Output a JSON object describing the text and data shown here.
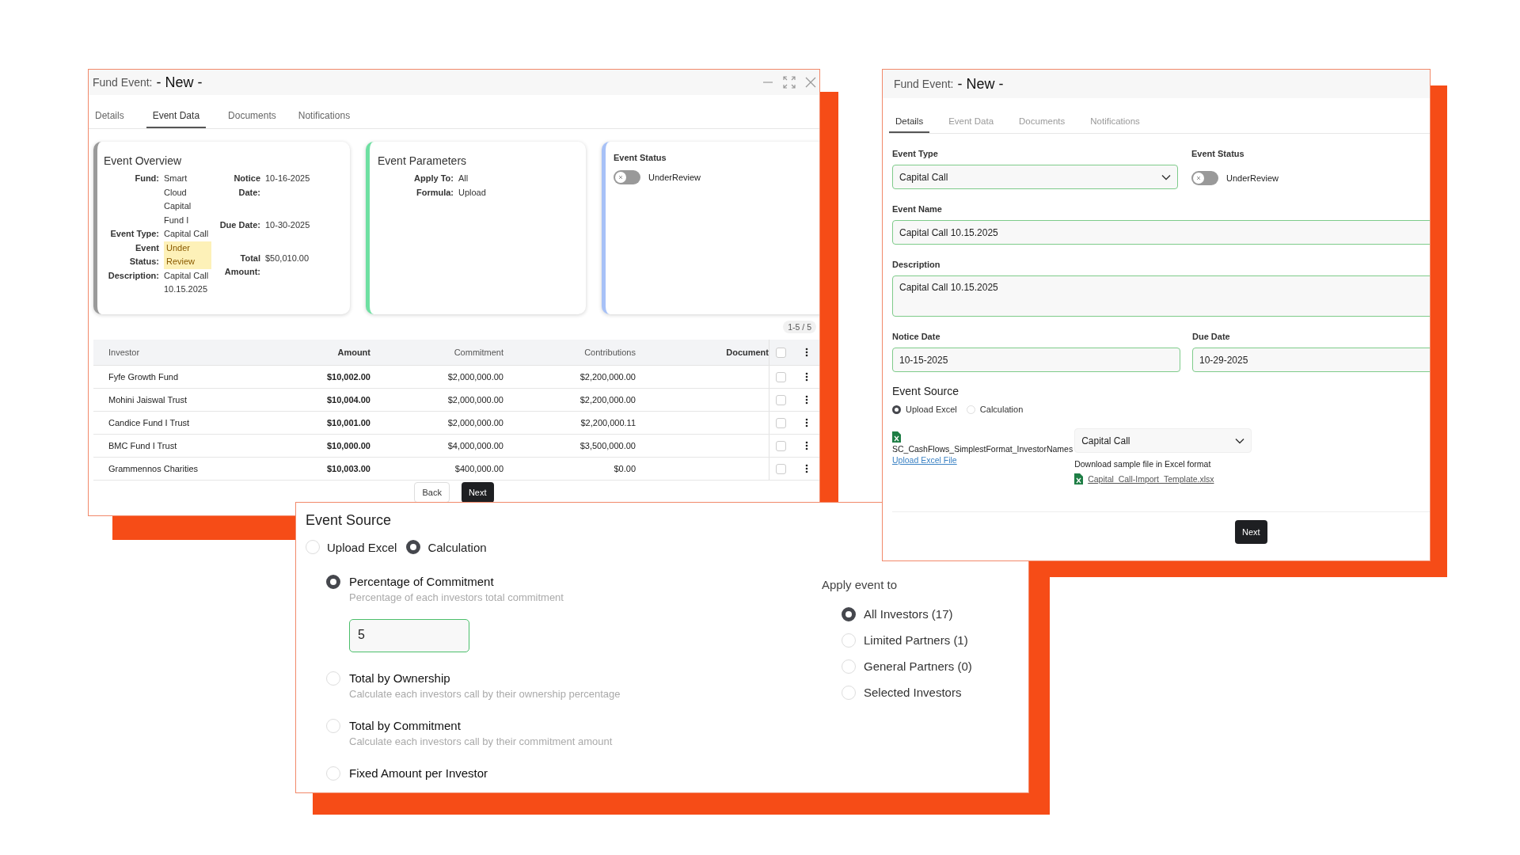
{
  "event_data_window": {
    "title_prefix": "Fund Event:",
    "title": "- New -",
    "tabs": [
      {
        "label": "Details",
        "selected": false
      },
      {
        "label": "Event Data",
        "selected": true
      },
      {
        "label": "Documents",
        "selected": false
      },
      {
        "label": "Notifications",
        "selected": false
      }
    ],
    "overview": {
      "title": "Event Overview",
      "left_fields": [
        {
          "label": "Fund:",
          "value": "Smart Cloud Capital Fund I",
          "highlighted": false
        },
        {
          "label": "Event Type:",
          "value": "Capital Call",
          "highlighted": false
        },
        {
          "label": "Event Status:",
          "value": "Under Review",
          "highlighted": true
        },
        {
          "label": "Description:",
          "value": "Capital Call 10.15.2025",
          "highlighted": false
        }
      ],
      "right_fields": [
        {
          "label": "Notice Date:",
          "value": "10-16-2025"
        },
        {
          "label": "Due Date:",
          "value": "10-30-2025"
        },
        {
          "label": "Total Amount:",
          "value": "$50,010.00"
        }
      ]
    },
    "parameters": {
      "title": "Event Parameters",
      "fields": [
        {
          "label": "Apply To:",
          "value": "All"
        },
        {
          "label": "Formula:",
          "value": "Upload"
        }
      ]
    },
    "status": {
      "title": "Event Status",
      "on": false,
      "label": "UnderReview"
    },
    "pagination": "1-5 / 5",
    "table": {
      "columns": [
        "Investor",
        "Amount",
        "Commitment",
        "Contributions",
        "Document"
      ],
      "all_checked": false,
      "rows": [
        {
          "investor": "Fyfe Growth Fund",
          "amount": "$10,002.00",
          "commitment": "$2,000,000.00",
          "contributions": "$2,200,000.00",
          "checked": false
        },
        {
          "investor": "Mohini Jaiswal Trust",
          "amount": "$10,004.00",
          "commitment": "$2,000,000.00",
          "contributions": "$2,200,000.00",
          "checked": false
        },
        {
          "investor": "Candice Fund I Trust",
          "amount": "$10,001.00",
          "commitment": "$2,000,000.00",
          "contributions": "$2,200,000.11",
          "checked": false
        },
        {
          "investor": "BMC Fund I Trust",
          "amount": "$10,000.00",
          "commitment": "$4,000,000.00",
          "contributions": "$3,500,000.00",
          "checked": false
        },
        {
          "investor": "Grammennos Charities",
          "amount": "$10,003.00",
          "commitment": "$400,000.00",
          "contributions": "$0.00",
          "checked": false
        }
      ]
    },
    "buttons": [
      "Back",
      "Next"
    ]
  },
  "details_window": {
    "title_prefix": "Fund Event:",
    "title": "- New -",
    "tabs": [
      {
        "label": "Details",
        "selected": true
      },
      {
        "label": "Event Data",
        "selected": false
      },
      {
        "label": "Documents",
        "selected": false
      },
      {
        "label": "Notifications",
        "selected": false
      }
    ],
    "event_type": {
      "label": "Event Type",
      "value": "Capital Call"
    },
    "event_status": {
      "label": "Event Status",
      "on": false,
      "text": "UnderReview"
    },
    "event_name": {
      "label": "Event Name",
      "value": "Capital Call 10.15.2025"
    },
    "description": {
      "label": "Description",
      "value": "Capital Call 10.15.2025"
    },
    "notice_date": {
      "label": "Notice Date",
      "value": "10-15-2025"
    },
    "due_date": {
      "label": "Due Date",
      "value": "10-29-2025"
    },
    "event_source": {
      "title": "Event Source",
      "options": [
        {
          "label": "Upload Excel",
          "selected": true
        },
        {
          "label": "Calculation",
          "selected": false
        }
      ]
    },
    "file_name": "SC_CashFlows_SimplestFormat_InvestorNames",
    "upload_link": "Upload Excel File",
    "template_select": "Capital Call",
    "download_note": "Download sample file in Excel format",
    "template_link": "Capital_Call-Import_Template.xlsx",
    "next_button": "Next"
  },
  "calculation_panel": {
    "title": "Event Source",
    "sources": [
      {
        "label": "Upload Excel",
        "selected": false
      },
      {
        "label": "Calculation",
        "selected": true
      }
    ],
    "methods": [
      {
        "label": "Percentage of Commitment",
        "description": "Percentage of each investors total commitment",
        "value": "5",
        "selected": true
      },
      {
        "label": "Total by Ownership",
        "description": "Calculate each investors call by their ownership percentage",
        "selected": false
      },
      {
        "label": "Total by Commitment",
        "description": "Calculate each investors call by their commitment amount",
        "selected": false
      },
      {
        "label": "Fixed Amount per Investor",
        "selected": false
      }
    ],
    "apply_title": "Apply event to",
    "apply_options": [
      {
        "label": "All Investors (17)",
        "selected": true
      },
      {
        "label": "Limited Partners (1)",
        "selected": false
      },
      {
        "label": "General Partners (0)",
        "selected": false
      },
      {
        "label": "Selected Investors",
        "selected": false
      }
    ]
  }
}
